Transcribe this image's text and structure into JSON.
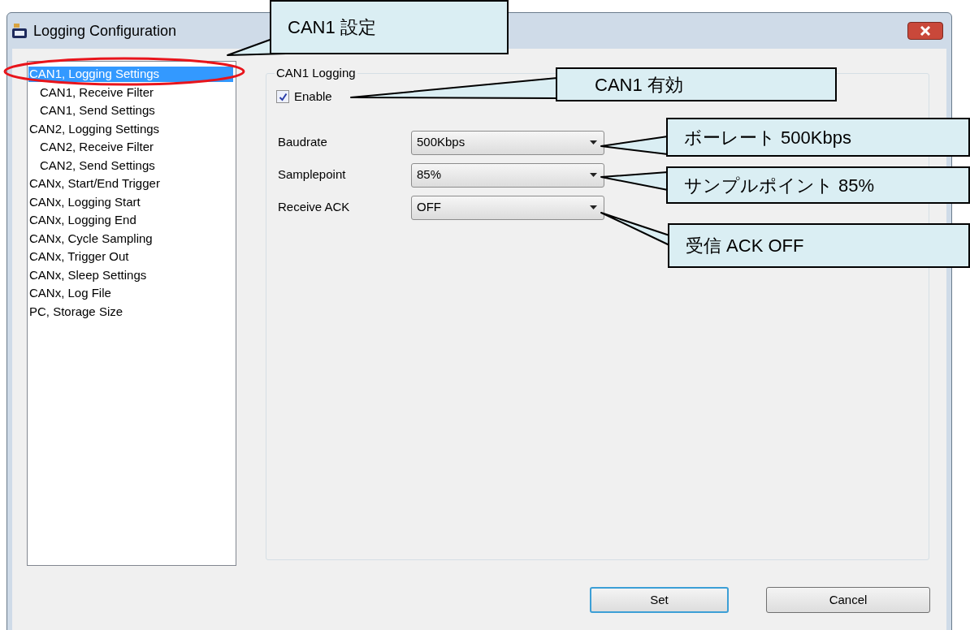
{
  "window": {
    "title": "Logging Configuration"
  },
  "tree": {
    "items": [
      {
        "label": "CAN1, Logging Settings",
        "selected": true,
        "children": [
          {
            "label": "CAN1, Receive Filter",
            "selected": false
          },
          {
            "label": "CAN1, Send Settings",
            "selected": false
          }
        ]
      },
      {
        "label": "CAN2, Logging Settings",
        "selected": false,
        "children": [
          {
            "label": "CAN2, Receive Filter",
            "selected": false
          },
          {
            "label": "CAN2, Send Settings",
            "selected": false
          }
        ]
      },
      {
        "label": "CANx, Start/End Trigger",
        "selected": false
      },
      {
        "label": "CANx, Logging Start",
        "selected": false
      },
      {
        "label": "CANx, Logging End",
        "selected": false
      },
      {
        "label": "CANx, Cycle Sampling",
        "selected": false
      },
      {
        "label": "CANx, Trigger Out",
        "selected": false
      },
      {
        "label": "CANx, Sleep Settings",
        "selected": false
      },
      {
        "label": "CANx, Log File",
        "selected": false
      },
      {
        "label": "PC, Storage Size",
        "selected": false
      }
    ]
  },
  "group": {
    "title": "CAN1 Logging",
    "enable": {
      "label": "Enable",
      "checked": true
    },
    "fields": [
      {
        "label": "Baudrate",
        "value": "500Kbps"
      },
      {
        "label": "Samplepoint",
        "value": "85%"
      },
      {
        "label": "Receive ACK",
        "value": "OFF"
      }
    ]
  },
  "buttons": [
    {
      "label": "Set",
      "default": true
    },
    {
      "label": "Cancel",
      "default": false
    }
  ],
  "annotations": [
    {
      "text": "CAN1 設定"
    },
    {
      "text": "CAN1  有効"
    },
    {
      "text": "ボーレート 500Kbps"
    },
    {
      "text": "サンプルポイント 85%"
    },
    {
      "text": "受信 ACK OFF"
    }
  ]
}
